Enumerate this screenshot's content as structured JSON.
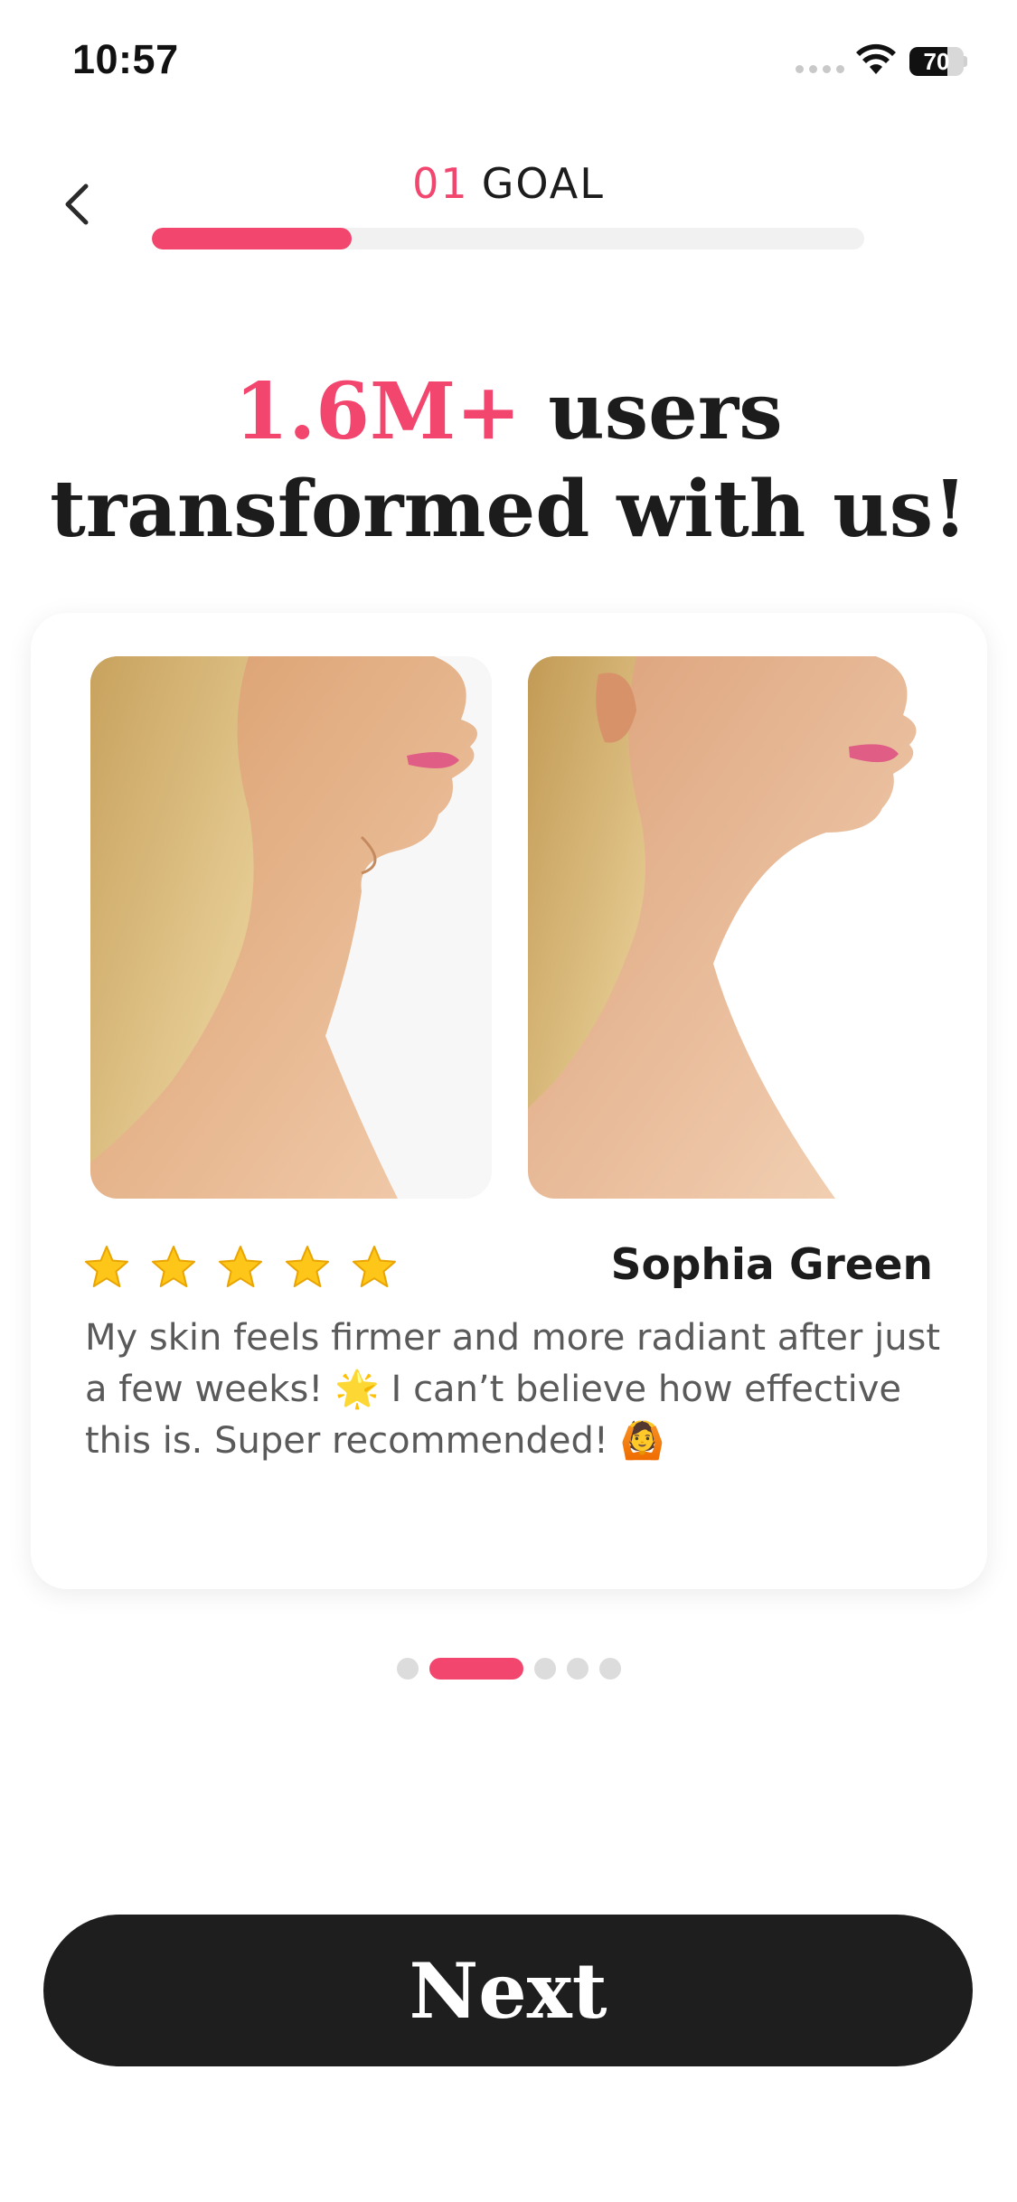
{
  "status_bar": {
    "time": "10:57",
    "battery_level": "70"
  },
  "header": {
    "step_number": "01",
    "step_label": "GOAL",
    "progress_fraction": 0.28
  },
  "headline": {
    "accent": "1.6M+",
    "line1_rest": "users",
    "line2": "transformed with us!"
  },
  "review": {
    "rating": 5,
    "reviewer_name": "Sophia Green",
    "text": "My skin feels firmer and more radiant after just a few weeks! 🌟  I can’t believe how effective this is. Super recommended! 🙆"
  },
  "pager": {
    "total": 5,
    "active_index": 1
  },
  "footer": {
    "next_label": "Next"
  },
  "colors": {
    "accent": "#f2466f",
    "button": "#1e1e1e",
    "star": "#ffc61a"
  }
}
